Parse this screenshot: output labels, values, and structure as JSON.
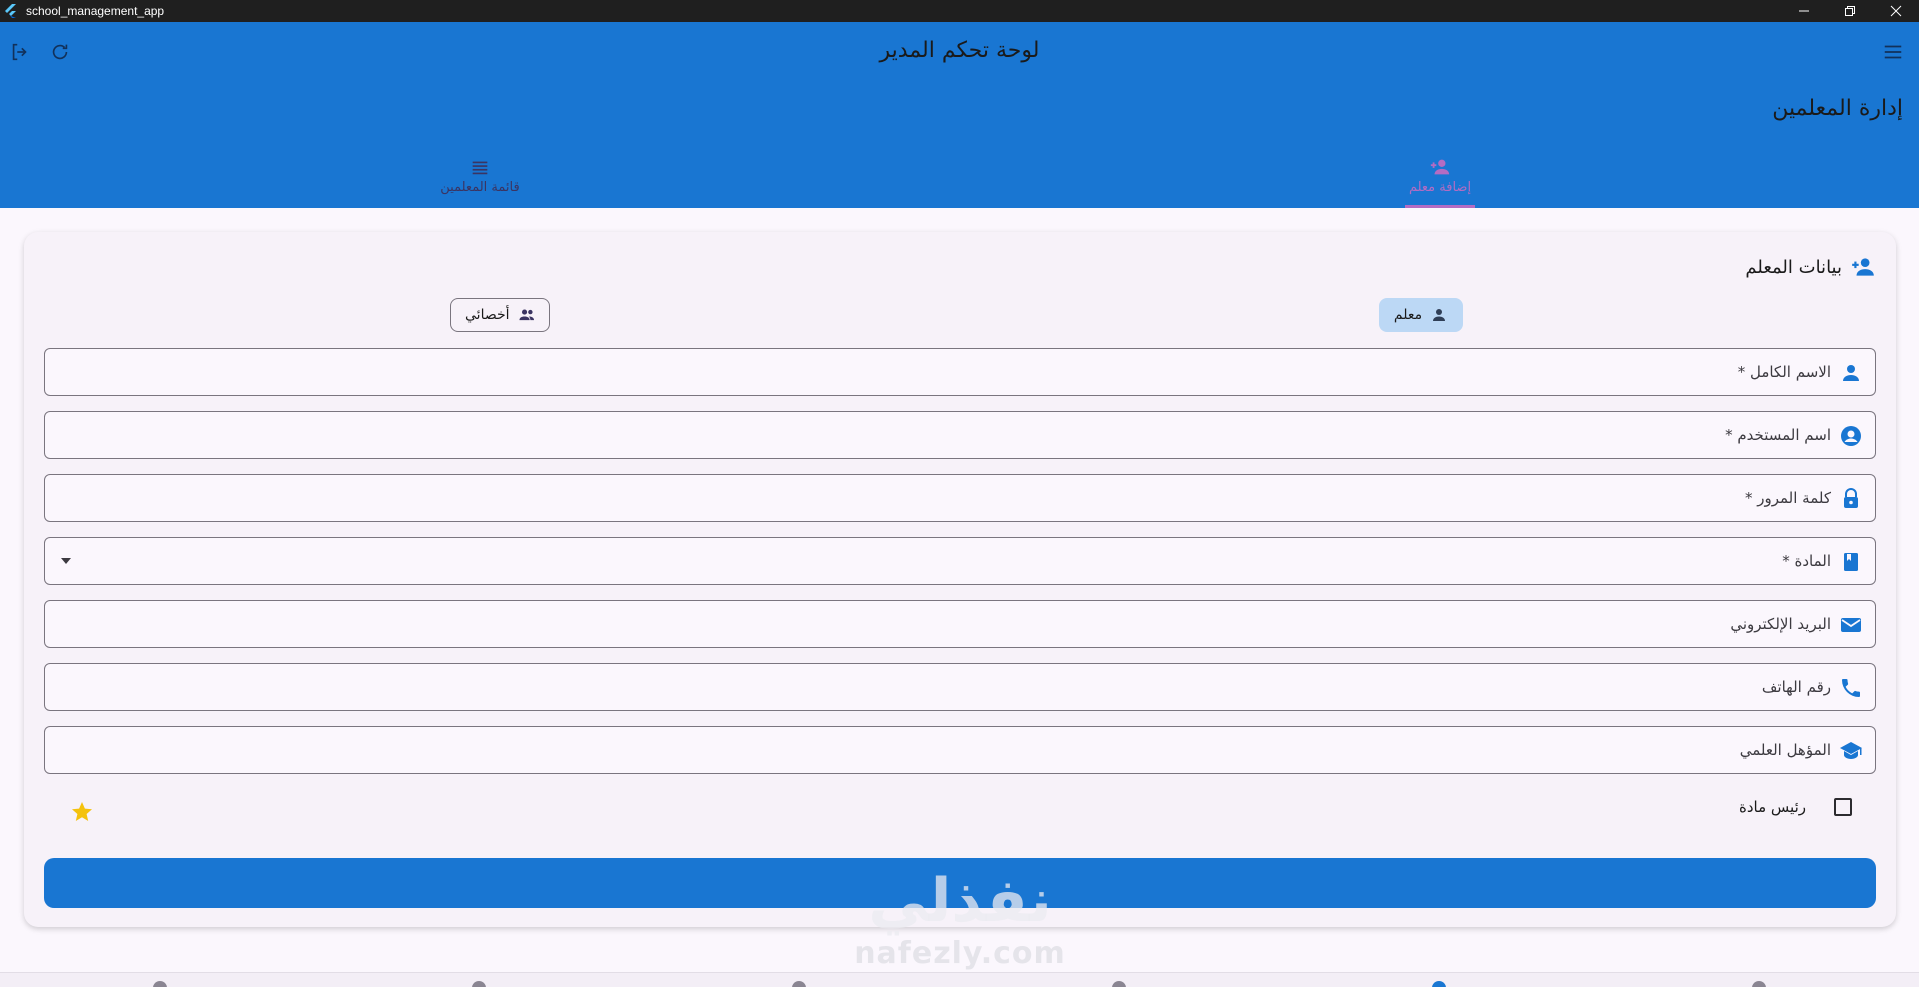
{
  "window": {
    "title": "school_management_app"
  },
  "appbar": {
    "title": "لوحة تحكم المدير",
    "section_title": "إدارة المعلمين"
  },
  "tabs": [
    {
      "label": "إضافة معلم",
      "icon": "person-add-icon",
      "selected": true
    },
    {
      "label": "قائمة المعلمين",
      "icon": "list-icon",
      "selected": false
    }
  ],
  "card": {
    "title": "بيانات المعلم",
    "chips": [
      {
        "label": "معلم",
        "icon": "person-icon",
        "selected": true
      },
      {
        "label": "أخصائي",
        "icon": "people-icon",
        "selected": false
      }
    ],
    "fields": [
      {
        "label": "الاسم الكامل *",
        "icon": "person-icon"
      },
      {
        "label": "اسم المستخدم *",
        "icon": "account-circle-icon"
      },
      {
        "label": "كلمة المرور *",
        "icon": "lock-icon"
      },
      {
        "label": "المادة *",
        "icon": "book-icon",
        "dropdown": true
      },
      {
        "label": "البريد الإلكتروني",
        "icon": "email-icon"
      },
      {
        "label": "رقم الهاتف",
        "icon": "phone-icon"
      },
      {
        "label": "المؤهل العلمي",
        "icon": "school-icon"
      }
    ],
    "checkbox_label": "رئيس مادة",
    "checkbox_checked": false
  },
  "watermark": {
    "arabic": "نفذلي",
    "latin": "nafezly.com"
  },
  "colors": {
    "primary": "#1976d2",
    "accent": "#b36cc3",
    "star": "#f4c20d",
    "chip_selected": "#bcd8f5"
  }
}
